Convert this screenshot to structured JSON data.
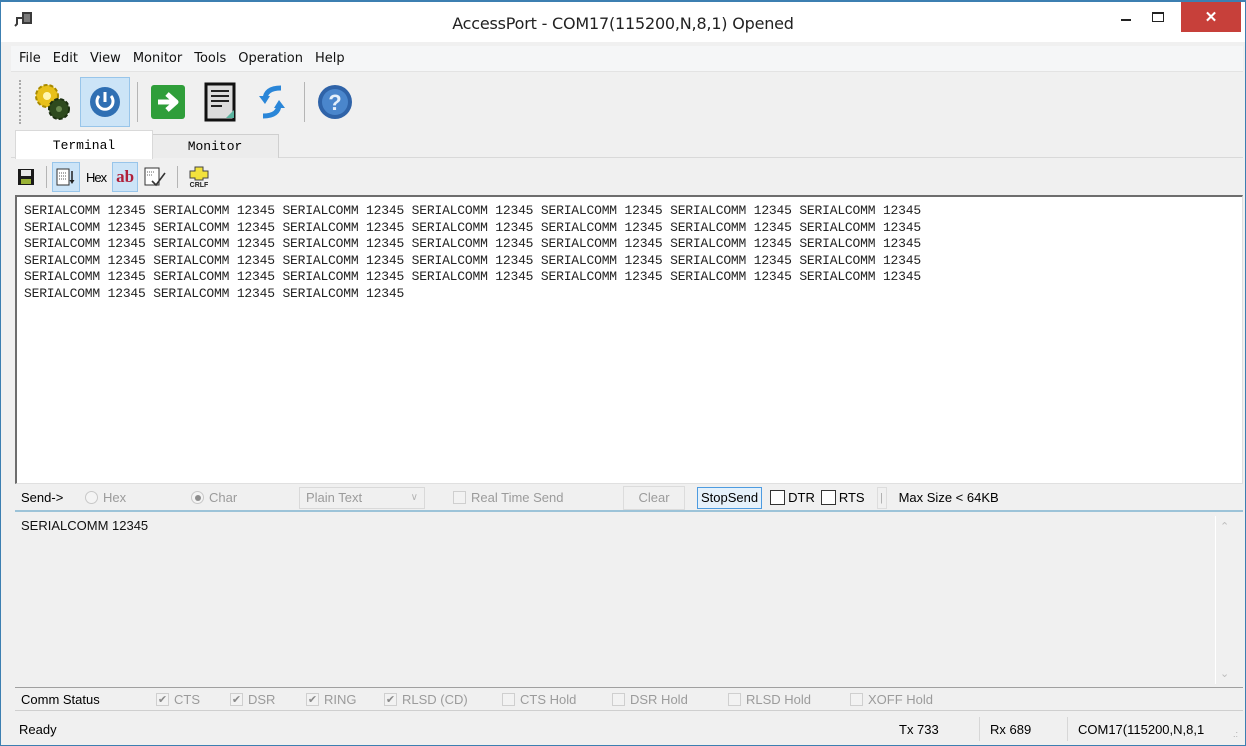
{
  "window": {
    "title": "AccessPort - COM17(115200,N,8,1) Opened",
    "icons": {
      "app": "serial-port-plug-icon",
      "minimize": "minimize-icon",
      "maximize": "maximize-icon",
      "close": "close-icon"
    },
    "close_glyph": "✕"
  },
  "menu": {
    "items": [
      "File",
      "Edit",
      "View",
      "Monitor",
      "Tools",
      "Operation",
      "Help"
    ]
  },
  "toolbar": {
    "buttons": [
      {
        "icon": "gears-settings-icon",
        "active": false
      },
      {
        "icon": "power-icon",
        "active": true
      },
      {
        "icon": "green-arrow-right-icon",
        "active": false
      },
      {
        "icon": "document-icon",
        "active": false
      },
      {
        "icon": "refresh-arrows-icon",
        "active": false
      },
      {
        "icon": "help-icon",
        "active": false
      }
    ]
  },
  "tabs": [
    {
      "label": "Terminal",
      "selected": true
    },
    {
      "label": "Monitor",
      "selected": false
    }
  ],
  "terminal_toolbar": {
    "save_icon": "save-disk-icon",
    "autoscroll_icon": "autoscroll-icon",
    "hex_label": "Hex",
    "ab_label": "ab",
    "edit_icon": "clear-edit-icon",
    "crlf_icon": "crlf-icon",
    "crlf_label": "CRLF"
  },
  "terminal": {
    "lines": [
      "SERIALCOMM 12345 SERIALCOMM 12345 SERIALCOMM 12345 SERIALCOMM 12345 SERIALCOMM 12345 SERIALCOMM 12345 SERIALCOMM 12345",
      "SERIALCOMM 12345 SERIALCOMM 12345 SERIALCOMM 12345 SERIALCOMM 12345 SERIALCOMM 12345 SERIALCOMM 12345 SERIALCOMM 12345",
      "SERIALCOMM 12345 SERIALCOMM 12345 SERIALCOMM 12345 SERIALCOMM 12345 SERIALCOMM 12345 SERIALCOMM 12345 SERIALCOMM 12345",
      "SERIALCOMM 12345 SERIALCOMM 12345 SERIALCOMM 12345 SERIALCOMM 12345 SERIALCOMM 12345 SERIALCOMM 12345 SERIALCOMM 12345",
      "SERIALCOMM 12345 SERIALCOMM 12345 SERIALCOMM 12345 SERIALCOMM 12345 SERIALCOMM 12345 SERIALCOMM 12345 SERIALCOMM 12345",
      "SERIALCOMM 12345 SERIALCOMM 12345 SERIALCOMM 12345"
    ]
  },
  "send_bar": {
    "label": "Send->",
    "hex_radio": {
      "label": "Hex",
      "selected": false
    },
    "char_radio": {
      "label": "Char",
      "selected": true
    },
    "format_select": {
      "value": "Plain Text"
    },
    "real_time_send": {
      "label": "Real Time Send",
      "checked": false
    },
    "clear_label": "Clear",
    "stop_send_label": "StopSend",
    "dtr": {
      "label": "DTR",
      "checked": false
    },
    "rts": {
      "label": "RTS",
      "checked": false
    },
    "divider_glyph": "|",
    "max_size": "Max Size < 64KB"
  },
  "send_area": {
    "text": "SERIALCOMM 12345",
    "scroll_up": "⌃",
    "scroll_down": "⌄"
  },
  "comm_status": {
    "label": "Comm Status",
    "items": [
      {
        "label": "CTS",
        "checked": true
      },
      {
        "label": "DSR",
        "checked": true
      },
      {
        "label": "RING",
        "checked": true
      },
      {
        "label": "RLSD (CD)",
        "checked": true
      },
      {
        "label": "CTS Hold",
        "checked": false
      },
      {
        "label": "DSR Hold",
        "checked": false
      },
      {
        "label": "RLSD Hold",
        "checked": false
      },
      {
        "label": "XOFF Hold",
        "checked": false
      }
    ],
    "check_glyph": "✔"
  },
  "status_bar": {
    "status": "Ready",
    "tx": "Tx 733",
    "rx": "Rx 689",
    "port": "COM17(115200,N,8,1",
    "grip_glyph": ".:"
  }
}
